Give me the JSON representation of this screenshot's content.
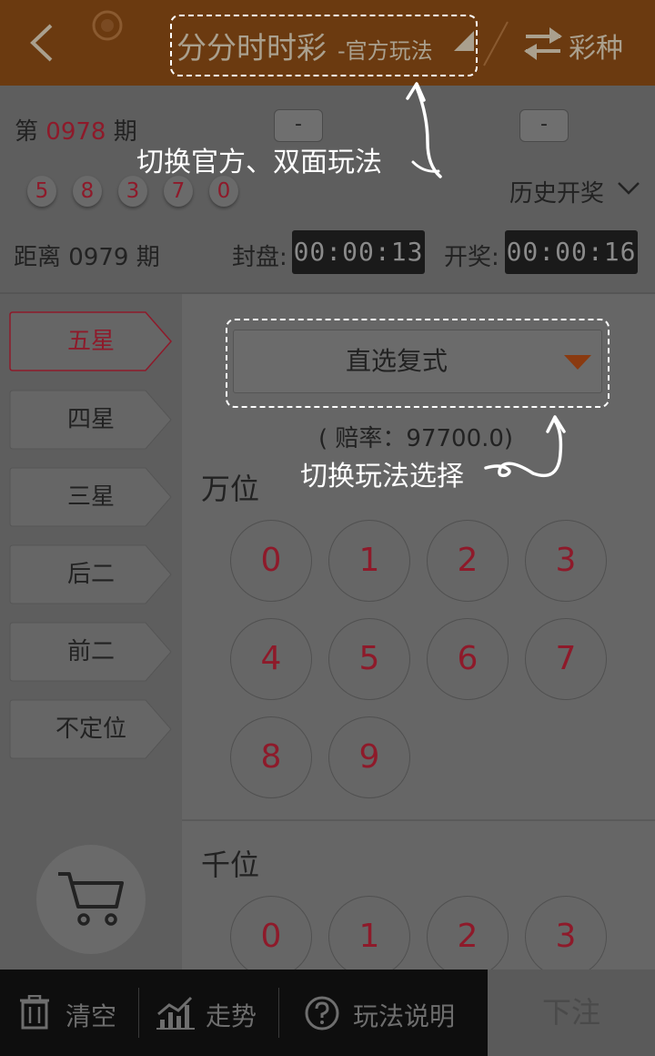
{
  "header": {
    "title": "分分时时彩",
    "subtitle": "-官方玩法",
    "switch_label": "彩种"
  },
  "issue": {
    "prefix": "第",
    "number": "0978",
    "suffix": "期",
    "dash_left": "-",
    "dash_right": "-",
    "balls": [
      "5",
      "8",
      "3",
      "7",
      "0"
    ],
    "history_label": "历史开奖"
  },
  "countdown": {
    "next_label": "距离 0979 期",
    "close_label": "封盘:",
    "close_time": "00:00:13",
    "open_label": "开奖:",
    "open_time": "00:00:16"
  },
  "annotations": {
    "switch_mode": "切换官方、双面玩法",
    "switch_play": "切换玩法选择"
  },
  "tabs": [
    "五星",
    "四星",
    "三星",
    "后二",
    "前二",
    "不定位"
  ],
  "play": {
    "selected": "直选复式",
    "odds": "( 赔率：97700.0)"
  },
  "positions": [
    {
      "label": "万位",
      "numbers": [
        "0",
        "1",
        "2",
        "3",
        "4",
        "5",
        "6",
        "7",
        "8",
        "9"
      ]
    },
    {
      "label": "千位",
      "numbers": [
        "0",
        "1",
        "2",
        "3"
      ]
    }
  ],
  "bottom_bar": {
    "clear": "清空",
    "trend": "走势",
    "rules": "玩法说明",
    "submit": "下注"
  }
}
